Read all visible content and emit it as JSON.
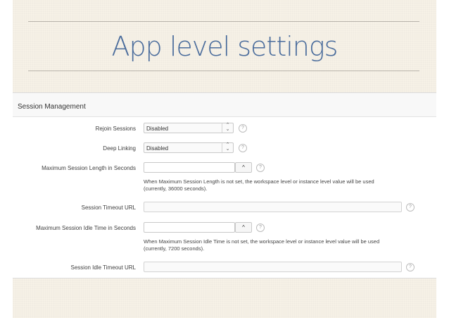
{
  "slide": {
    "title": "App level settings"
  },
  "panel": {
    "title": "Session Management"
  },
  "fields": {
    "rejoin": {
      "label": "Rejoin Sessions",
      "value": "Disabled"
    },
    "deep": {
      "label": "Deep Linking",
      "value": "Disabled"
    },
    "max_length": {
      "label": "Maximum Session Length in Seconds",
      "value": "",
      "note_line1": "When Maximum Session Length is not set, the workspace level or instance level value will be used",
      "note_line2": "(currently, 36000 seconds)."
    },
    "timeout_url": {
      "label": "Session Timeout URL",
      "value": ""
    },
    "max_idle": {
      "label": "Maximum Session Idle Time in Seconds",
      "value": "",
      "note_line1": "When Maximum Session Idle Time is not set, the workspace level or instance level value will be used",
      "note_line2": "(currently, 7200 seconds)."
    },
    "idle_url": {
      "label": "Session Idle Timeout URL",
      "value": ""
    }
  },
  "icons": {
    "help": "?",
    "select_arrows": "⌃⌄",
    "spinner_up": "^"
  }
}
